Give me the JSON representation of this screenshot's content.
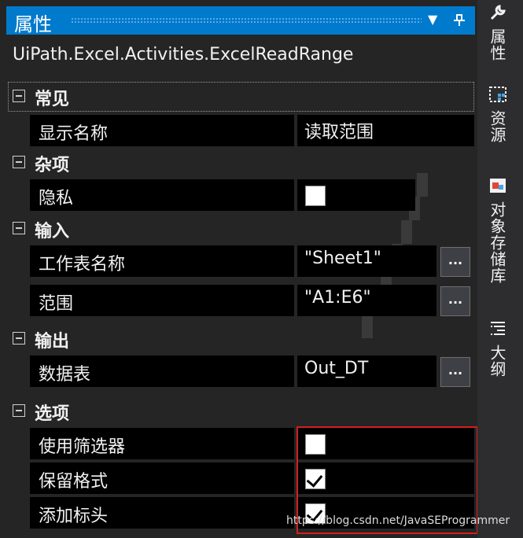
{
  "window": {
    "title": "属性"
  },
  "object_type": "UiPath.Excel.Activities.ExcelReadRange",
  "categories": {
    "common": {
      "label": "常见",
      "rows": {
        "display_name": {
          "label": "显示名称",
          "value": "读取范围"
        }
      }
    },
    "misc": {
      "label": "杂项",
      "rows": {
        "private": {
          "label": "隐私",
          "checked": false
        }
      }
    },
    "input": {
      "label": "输入",
      "rows": {
        "sheet_name": {
          "label": "工作表名称",
          "value": "\"Sheet1\""
        },
        "range": {
          "label": "范围",
          "value": "\"A1:E6\""
        }
      }
    },
    "output": {
      "label": "输出",
      "rows": {
        "data_table": {
          "label": "数据表",
          "value": "Out_DT"
        }
      }
    },
    "options": {
      "label": "选项",
      "rows": {
        "use_filter": {
          "label": "使用筛选器",
          "checked": false
        },
        "preserve_format": {
          "label": "保留格式",
          "checked": true
        },
        "add_headers": {
          "label": "添加标头",
          "checked": true
        }
      }
    }
  },
  "ellipsis_label": "...",
  "side_tabs": [
    {
      "label": "属性",
      "icon": "wrench-icon"
    },
    {
      "label": "资源",
      "icon": "resources-icon"
    },
    {
      "label": "对象存储库",
      "icon": "object-repository-icon"
    },
    {
      "label": "大纲",
      "icon": "outline-icon"
    }
  ],
  "watermark": "https://blog.csdn.net/JavaSEProgrammer",
  "colors": {
    "title_bar": "#007acc",
    "highlight_box": "#d21f1f",
    "panel_bg": "#252526"
  }
}
